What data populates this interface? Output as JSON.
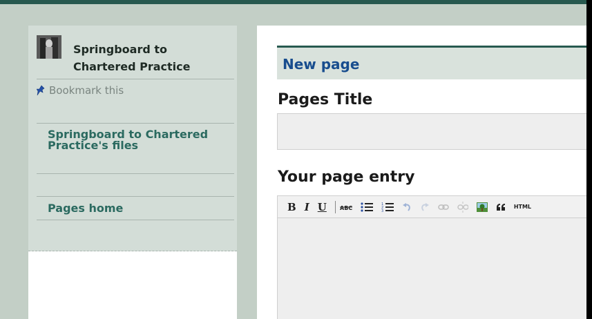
{
  "sidebar": {
    "group_name": "Springboard to Chartered Practice",
    "bookmark_label": "Bookmark this",
    "links": [
      {
        "label": "Springboard to Chartered Practice's files"
      },
      {
        "label": "Pages home"
      }
    ]
  },
  "main": {
    "heading": "New page",
    "title_label": "Pages Title",
    "title_value": "",
    "entry_label": "Your page entry"
  },
  "toolbar": {
    "bold": "B",
    "italic": "I",
    "underline": "U",
    "html": "HTML"
  },
  "colors": {
    "accent": "#27594f",
    "heading": "#184d8e",
    "link": "#2b6a60"
  }
}
